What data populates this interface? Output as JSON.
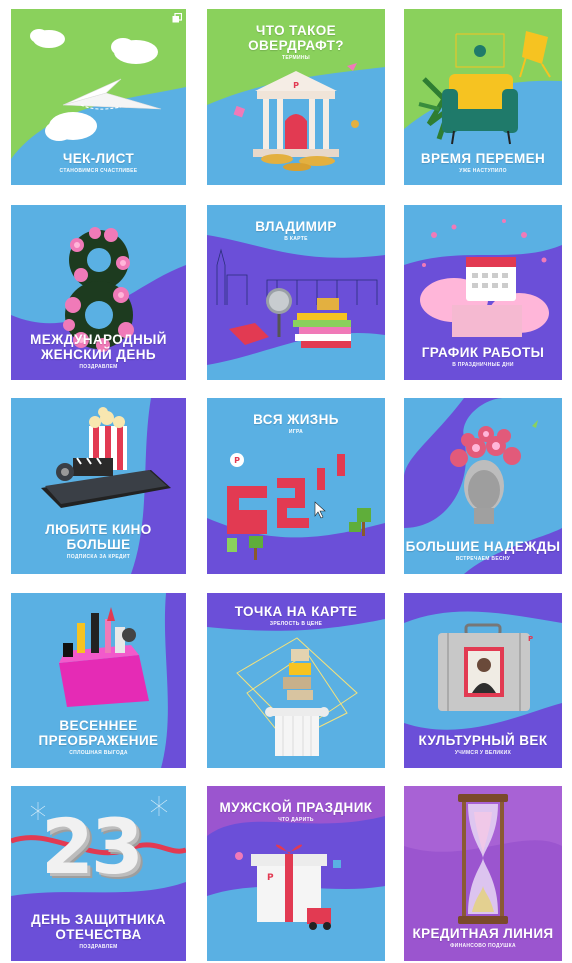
{
  "tiles": [
    {
      "title": "ЧЕК-ЛИСТ",
      "subtitle": "СТАНОВИМСЯ СЧАСТЛИВЕЕ"
    },
    {
      "title": "ЧТО ТАКОЕ\nОВЕРДРАФТ?",
      "subtitle": "ТЕРМИНЫ"
    },
    {
      "title": "ВРЕМЯ ПЕРЕМЕН",
      "subtitle": "УЖЕ НАСТУПИЛО"
    },
    {
      "title": "МЕЖДУНАРОДНЫЙ\nЖЕНСКИЙ ДЕНЬ",
      "subtitle": "ПОЗДРАВЛЕМ",
      "number": "8"
    },
    {
      "title": "ВЛАДИМИР",
      "subtitle": "В КАРТЕ"
    },
    {
      "title": "ГРАФИК РАБОТЫ",
      "subtitle": "В ПРАЗДНИЧНЫЕ ДНИ"
    },
    {
      "title": "ЛЮБИТЕ КИНО\nБОЛЬШЕ",
      "subtitle": "ПОДПИСКА ЗА КРЕДИТ"
    },
    {
      "title": "ВСЯ ЖИЗНЬ",
      "subtitle": "ИГРА",
      "number": "62"
    },
    {
      "title": "БОЛЬШИЕ НАДЕЖДЫ",
      "subtitle": "ВСТРЕЧАЕМ ВЕСНУ"
    },
    {
      "title": "ВЕСЕННЕЕ\nПРЕОБРАЖЕНИЕ",
      "subtitle": "СПЛОШНАЯ ВЫГОДА"
    },
    {
      "title": "ТОЧКА НА КАРТЕ",
      "subtitle": "ЗРЕЛОСТЬ В ЦЕНЕ"
    },
    {
      "title": "КУЛЬТУРНЫЙ ВЕК",
      "subtitle": "УЧИМСЯ У ВЕЛИКИХ"
    },
    {
      "title": "ДЕНЬ ЗАЩИТНИКА\nОТЕЧЕСТВА",
      "subtitle": "ПОЗДРАВЛЕМ",
      "number": "23"
    },
    {
      "title": "МУЖСКОЙ ПРАЗДНИК",
      "subtitle": "ЧТО ДАРИТЬ"
    },
    {
      "title": "КРЕДИТНАЯ ЛИНИЯ",
      "subtitle": "ФИНАНСОВО ПОДУШКА"
    }
  ],
  "colors": {
    "blue": "#5ab0e3",
    "green": "#8ad15c",
    "purple": "#6b4fd8",
    "violet": "#9b55cf",
    "red": "#e23a52",
    "pink": "#f07ab8",
    "white": "#ffffff"
  },
  "icons": [
    "paper-plane-icon",
    "bank-building-icon",
    "armchair-icon",
    "flower-eight-icon",
    "microphone-icon",
    "calendar-icon",
    "popcorn-clapper-icon",
    "pixel-numbers-icon",
    "statue-flowers-icon",
    "cosmetics-bag-icon",
    "column-stones-icon",
    "suitcase-portrait-icon",
    "ribbon-23-icon",
    "gift-truck-icon",
    "hourglass-icon"
  ]
}
